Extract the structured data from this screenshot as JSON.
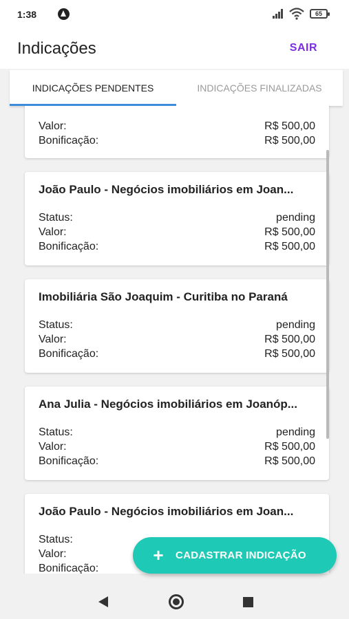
{
  "status_bar": {
    "time": "1:38",
    "battery": "65"
  },
  "app_bar": {
    "title": "Indicações",
    "logout_label": "SAIR"
  },
  "tabs": [
    {
      "label": "INDICAÇÕES PENDENTES",
      "active": true
    },
    {
      "label": "INDICAÇÕES FINALIZADAS",
      "active": false
    }
  ],
  "labels": {
    "status": "Status:",
    "value": "Valor:",
    "bonus": "Bonificação:"
  },
  "cards": [
    {
      "title": "",
      "status": "",
      "value": "R$ 500,00",
      "bonus": "R$ 500,00"
    },
    {
      "title": "João Paulo - Negócios imobiliários em Joan...",
      "status": "pending",
      "value": "R$ 500,00",
      "bonus": "R$ 500,00"
    },
    {
      "title": "Imobiliária São Joaquim - Curitiba no Paraná",
      "status": "pending",
      "value": "R$ 500,00",
      "bonus": "R$ 500,00"
    },
    {
      "title": "Ana Julia - Negócios imobiliários em Joanóp...",
      "status": "pending",
      "value": "R$ 500,00",
      "bonus": "R$ 500,00"
    },
    {
      "title": "João Paulo - Negócios imobiliários em Joan...",
      "status": "",
      "value": "",
      "bonus": ""
    }
  ],
  "fab": {
    "label": "CADASTRAR INDICAÇÃO"
  },
  "colors": {
    "accent": "#7a2fe0",
    "fab": "#1ec9b5",
    "tab_indicator": "#3b8ddc"
  }
}
